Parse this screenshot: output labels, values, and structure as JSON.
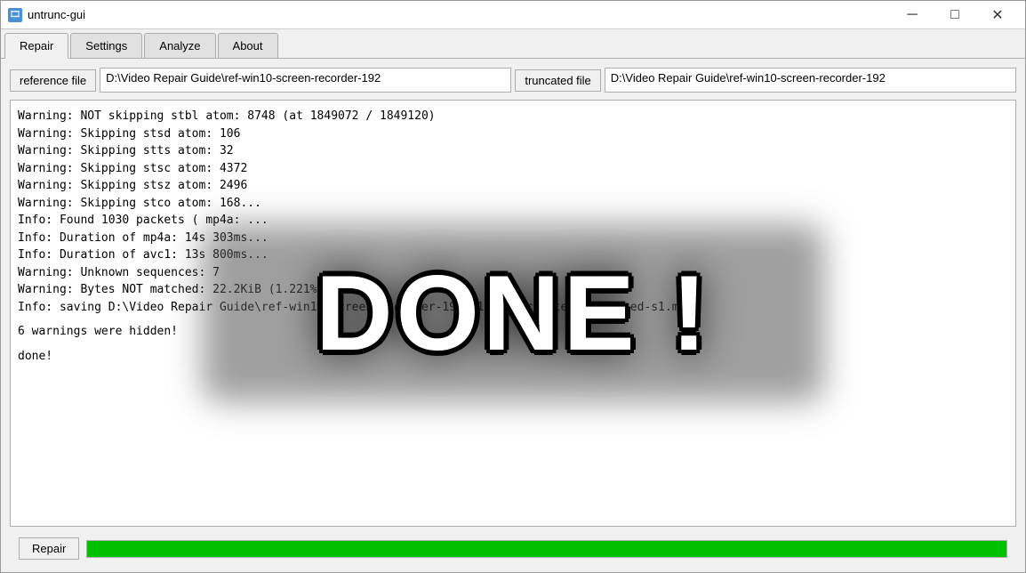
{
  "window": {
    "title": "untrunc-gui",
    "icon": "🎞"
  },
  "titlebar": {
    "minimize": "─",
    "maximize": "□",
    "close": "✕"
  },
  "tabs": [
    {
      "label": "Repair",
      "active": true
    },
    {
      "label": "Settings",
      "active": false
    },
    {
      "label": "Analyze",
      "active": false
    },
    {
      "label": "About",
      "active": false
    }
  ],
  "reference_file": {
    "button_label": "reference file",
    "value": "D:\\Video Repair Guide\\ref-win10-screen-recorder-192"
  },
  "truncated_file": {
    "button_label": "truncated file",
    "value": "D:\\Video Repair Guide\\ref-win10-screen-recorder-192"
  },
  "log": {
    "lines": [
      "Warning: NOT skipping stbl atom: 8748 (at 1849072 / 1849120)",
      "Warning: Skipping stsd atom: 106",
      "Warning: Skipping stts atom: 32",
      "Warning: Skipping stsc atom: 4372",
      "Warning: Skipping stsz atom: 2496",
      "Warning: Skipping stco atom: 168...",
      "Info: Found 1030 packets ( mp4a: ...",
      "Info: Duration of mp4a: 14s 303ms...",
      "Info: Duration of avc1: 13s 800ms...",
      "Warning: Unknown sequences: 7",
      "Warning: Bytes NOT matched: 22.2KiB (1.221%)",
      "Info: saving D:\\Video Repair Guide\\ref-win10-screen-recorder-1920x1080-corrupted.mp4_fixed-s1.mp4"
    ],
    "spacer1": "",
    "hidden_warnings": "6 warnings were hidden!",
    "spacer2": "",
    "done_text": "done!"
  },
  "done_overlay": "DONE !",
  "progress": {
    "percent": 100
  },
  "repair_button": "Repair"
}
